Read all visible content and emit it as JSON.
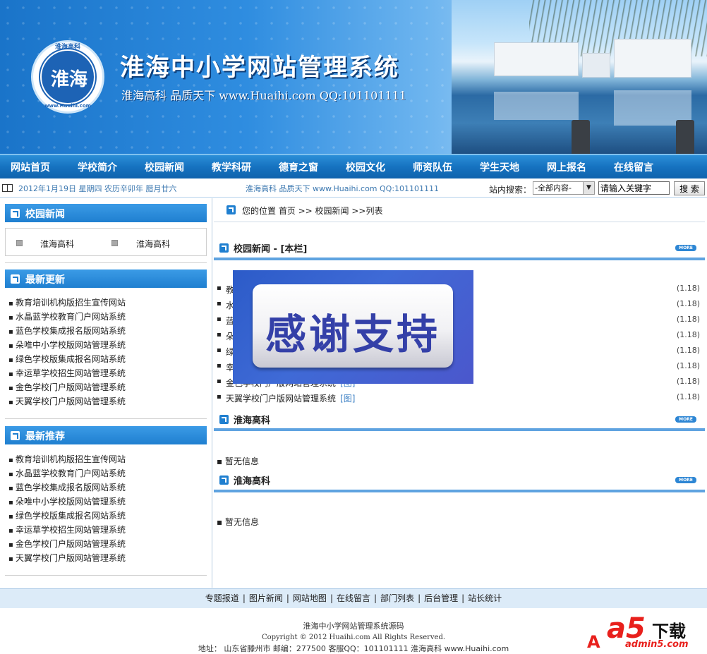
{
  "header": {
    "logo_text": "淮海",
    "logo_arc_top": "淮海高科",
    "logo_arc_bottom": "www.Huaihi.com",
    "title": "淮海中小学网站管理系统",
    "slogan": "淮海高科 品质天下 www.Huaihi.com QQ:101101111"
  },
  "nav": [
    "网站首页",
    "学校简介",
    "校园新闻",
    "教学科研",
    "德育之窗",
    "校园文化",
    "师资队伍",
    "学生天地",
    "网上报名",
    "在线留言"
  ],
  "infobar": {
    "date": "2012年1月19日 星期四 农历辛卯年 腊月廿六",
    "slogan": "淮海高科 品质天下 www.Huaihi.com QQ:101101111",
    "search_label": "站内搜索：",
    "search_select": "-全部内容-",
    "search_placeholder": "请输入关键字",
    "search_button": "搜 索"
  },
  "sidebar": {
    "campus_news_title": "校园新闻",
    "campus_news_subs": [
      "淮海高科",
      "淮海高科"
    ],
    "latest_title": "最新更新",
    "latest_items": [
      "教育培训机构版招生宣传网站",
      "水晶蓝学校教育门户网站系统",
      "蓝色学校集成报名版网站系统",
      "朵唯中小学校版网站管理系统",
      "绿色学校版集成报名网站系统",
      "幸运草学校招生网站管理系统",
      "金色学校门户版网站管理系统",
      "天翼学校门户版网站管理系统"
    ],
    "recommend_title": "最新推荐",
    "recommend_items": [
      "教育培训机构版招生宣传网站",
      "水晶蓝学校教育门户网站系统",
      "蓝色学校集成报名版网站系统",
      "朵唯中小学校版网站管理系统",
      "绿色学校版集成报名网站系统",
      "幸运草学校招生网站管理系统",
      "金色学校门户版网站管理系统",
      "天翼学校门户版网站管理系统"
    ]
  },
  "main": {
    "breadcrumb": "您的位置  首页 >> 校园新闻 >>列表",
    "section1_title": "校园新闻 - [本栏]",
    "more_label": "MORE",
    "news": [
      {
        "title": "教",
        "tag": "",
        "date": "(1.18)"
      },
      {
        "title": "水",
        "tag": "",
        "date": "(1.18)"
      },
      {
        "title": "蓝",
        "tag": "",
        "date": "(1.18)"
      },
      {
        "title": "朵",
        "tag": "",
        "date": "(1.18)"
      },
      {
        "title": "绿",
        "tag": "",
        "date": "(1.18)"
      },
      {
        "title": "幸",
        "tag": "",
        "date": "(1.18)"
      },
      {
        "title": "金色学校门户版网站管理系统",
        "tag": "[图]",
        "date": "(1.18)"
      },
      {
        "title": "天翼学校门户版网站管理系统",
        "tag": "[图]",
        "date": "(1.18)"
      }
    ],
    "section2_title": "淮海高科",
    "section2_empty": "暂无信息",
    "section3_title": "淮海高科",
    "section3_empty": "暂无信息"
  },
  "overlay": {
    "text": "感谢支持"
  },
  "footer": {
    "links": [
      "专题报道",
      "图片新闻",
      "网站地图",
      "在线留言",
      "部门列表",
      "后台管理",
      "站长统计"
    ],
    "line1": "淮海中小学网站管理系统源码",
    "line2": "Copyright © 2012 Huaihi.com All Rights Reserved.",
    "line3": "地址： 山东省滕州市 邮编：277500 客服QQ：101101111 淮海高科 www.Huaihi.com"
  },
  "watermark": {
    "a5": "a5",
    "dl": "下载",
    "url": "admin5.com",
    "A": "A"
  }
}
